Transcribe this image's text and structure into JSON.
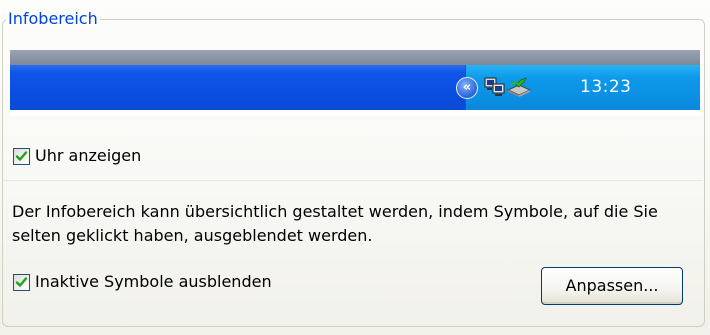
{
  "group": {
    "title": "Infobereich"
  },
  "taskbar": {
    "clock": "13:23",
    "toggle_glyph": "«",
    "tray_icons": [
      "network-icon",
      "safely-remove-hardware-icon"
    ]
  },
  "options": {
    "show_clock": {
      "label": "Uhr anzeigen",
      "checked": true
    },
    "description": "Der Infobereich kann übersichtlich gestaltet werden, indem Symbole, auf die Sie selten geklickt haben, ausgeblendet werden.",
    "hide_inactive": {
      "label": "Inaktive Symbole ausblenden",
      "checked": true
    },
    "customize_button": "Anpassen..."
  },
  "colors": {
    "legend_text": "#0046D5",
    "taskbar_blue": "#0A4FE0",
    "tray_blue": "#0B8FE3",
    "checkmark_green": "#21A121"
  }
}
